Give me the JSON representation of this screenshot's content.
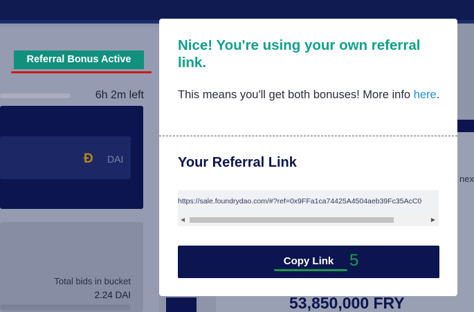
{
  "app": {
    "referral_badge": "Referral Bonus Active",
    "time_left": "6h 2m left",
    "currency_label": "DAI",
    "total_bids_label": "Total bids in bucket",
    "total_bids_value": "2.24 DAI",
    "fry_total": "53,850,000 FRY",
    "side_text": "nex",
    "progress_fraction": 0.0
  },
  "modal": {
    "title": "Nice! You're using your own referral link.",
    "body_text": "This means you'll get both bonuses! More info",
    "link_text": "here",
    "section_heading": "Your Referral Link",
    "referral_url": "https://sale.foundrydao.com/#?ref=0x9FFa1ca74425A4504aeb39Fc35AcC0",
    "copy_button": "Copy Link",
    "annotation_number": "5"
  },
  "icons": {
    "dai": "dai-currency-icon",
    "scroll_left": "scroll-left-arrow-icon",
    "scroll_right": "scroll-right-arrow-icon"
  },
  "colors": {
    "navy": "#0c1550",
    "teal": "#10a08b",
    "badge_bg": "#12907e",
    "link": "#1f8fcf",
    "annotation_red": "#d01717",
    "annotation_green": "#17a250"
  }
}
